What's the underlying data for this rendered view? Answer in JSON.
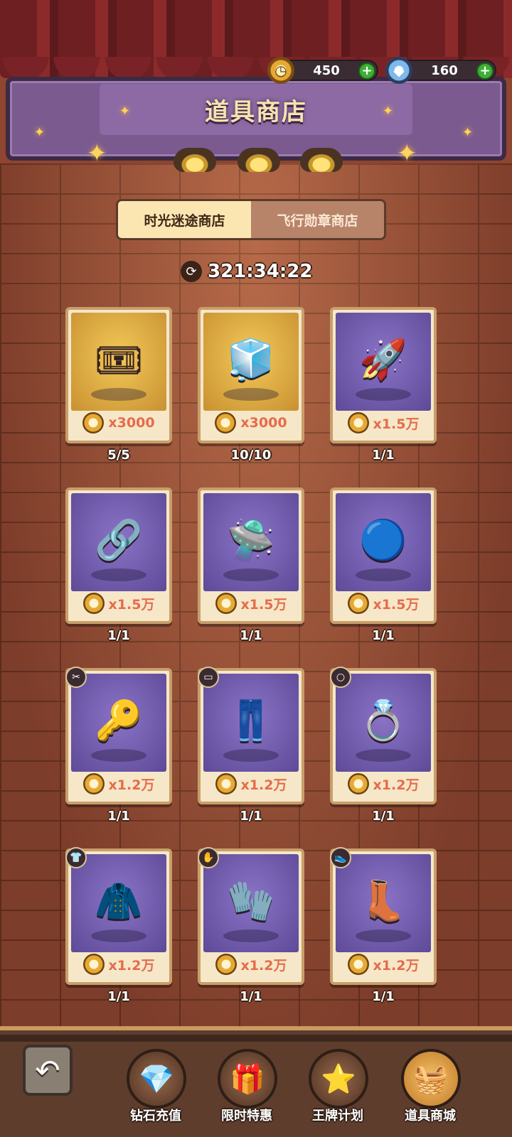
{
  "header": {
    "title": "道具商店",
    "coins": "450",
    "gems": "160",
    "coin_icon": "stopwatch-coin-icon",
    "gem_icon": "diamond-icon"
  },
  "tabs": [
    {
      "label": "时光迷途商店",
      "active": true
    },
    {
      "label": "飞行勋章商店",
      "active": false
    }
  ],
  "timer": {
    "value": "321:34:22",
    "icon": "refresh-icon"
  },
  "items": [
    {
      "name": "ticket",
      "price": "x3000",
      "stock": "5/5",
      "bg": "gold",
      "glyph": "🎟"
    },
    {
      "name": "gold-cube",
      "price": "x3000",
      "stock": "10/10",
      "bg": "gold",
      "glyph": "🧊"
    },
    {
      "name": "rocket-part",
      "price": "x1.5万",
      "stock": "1/1",
      "bg": "purple",
      "glyph": "🚀"
    },
    {
      "name": "ring-part",
      "price": "x1.5万",
      "stock": "1/1",
      "bg": "purple",
      "glyph": "🔗"
    },
    {
      "name": "engine-part",
      "price": "x1.5万",
      "stock": "1/1",
      "bg": "purple",
      "glyph": "🛸"
    },
    {
      "name": "sphere-part",
      "price": "x1.5万",
      "stock": "1/1",
      "bg": "purple",
      "glyph": "🔵"
    },
    {
      "name": "gem-scepter",
      "price": "x1.2万",
      "stock": "1/1",
      "bg": "purple",
      "glyph": "🔑",
      "slot": "✂"
    },
    {
      "name": "golden-pants",
      "price": "x1.2万",
      "stock": "1/1",
      "bg": "purple",
      "glyph": "👖",
      "slot": "▭"
    },
    {
      "name": "diamond-ring",
      "price": "x1.2万",
      "stock": "1/1",
      "bg": "purple",
      "glyph": "💍",
      "slot": "○"
    },
    {
      "name": "jacket",
      "price": "x1.2万",
      "stock": "1/1",
      "bg": "purple",
      "glyph": "🧥",
      "slot": "👕"
    },
    {
      "name": "glove",
      "price": "x1.2万",
      "stock": "1/1",
      "bg": "purple",
      "glyph": "🧤",
      "slot": "✋"
    },
    {
      "name": "winged-boots",
      "price": "x1.2万",
      "stock": "1/1",
      "bg": "purple",
      "glyph": "👢",
      "slot": "👟"
    }
  ],
  "nav": [
    {
      "label": "钻石充值",
      "icon": "diamond-chest-icon",
      "glyph": "💎"
    },
    {
      "label": "限时特惠",
      "icon": "gift-icon",
      "glyph": "🎁"
    },
    {
      "label": "王牌计划",
      "icon": "star-badge-icon",
      "glyph": "⭐"
    },
    {
      "label": "道具商城",
      "icon": "treasure-basket-icon",
      "glyph": "🧺",
      "active": true
    }
  ]
}
